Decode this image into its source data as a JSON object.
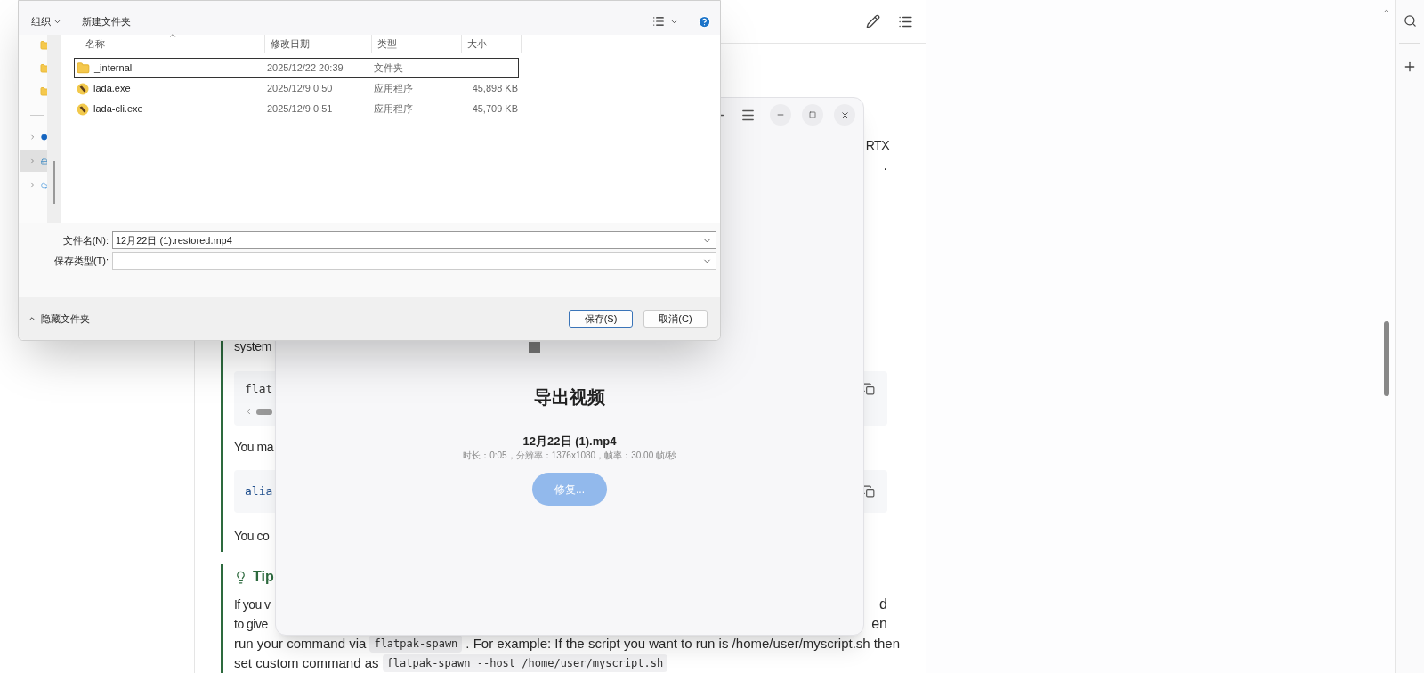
{
  "article": {
    "note_block": {
      "line_1_right": "RTX",
      "line_2_right": ".",
      "system_text": "system",
      "code_1": "flat",
      "you_may_text": "You ma",
      "code_2": "alia",
      "you_could_text": "You co"
    },
    "tip_block": {
      "title": "Tip",
      "line_1_left": "If you v",
      "line_1_right": "d",
      "line_2_left": "to give",
      "line_2_right": "en",
      "full_lines": [
        [
          {
            "kind": "text",
            "text": "run your command via"
          },
          {
            "kind": "code",
            "text": "flatpak-spawn"
          },
          {
            "kind": "text",
            "text": ". For example: If the script you want to run is /home/user/myscript.sh then"
          }
        ],
        [
          {
            "kind": "text",
            "text": "set custom command as"
          },
          {
            "kind": "code",
            "text": "flatpak-spawn --host /home/user/myscript.sh"
          }
        ]
      ]
    }
  },
  "export_window": {
    "title": "导出视频",
    "file_name": "12月22日 (1).mp4",
    "meta": "时长：0:05，分辨率：1376x1080，帧率：30.00 帧/秒",
    "repair_button": {
      "label": "修复...",
      "disabled": true
    }
  },
  "save_dialog": {
    "organize": "组织",
    "new_folder": "新建文件夹",
    "nav_items": [
      {
        "kind": "dot",
        "selected": false
      },
      {
        "kind": "drive",
        "selected": true
      },
      {
        "kind": "cloud",
        "selected": false
      }
    ],
    "columns": [
      "名称",
      "修改日期",
      "类型",
      "大小"
    ],
    "files": [
      {
        "kind": "folder",
        "name": "_internal",
        "modified": "2025/12/22 20:39",
        "type": "文件夹",
        "selected": true
      },
      {
        "kind": "app",
        "name": "lada.exe",
        "modified": "2025/12/9 0:50",
        "type": "应用程序",
        "size": "45,898 KB",
        "selected": false
      },
      {
        "kind": "app",
        "name": "lada-cli.exe",
        "modified": "2025/12/9 0:51",
        "type": "应用程序",
        "size": "45,709 KB",
        "selected": false
      }
    ],
    "file_name_label": "文件名(N):",
    "file_name_value": "12月22日 (1).restored.mp4",
    "file_type_label": "保存类型(T):",
    "hide_folders": "隐藏文件夹",
    "save": "保存(S)",
    "cancel": "取消(C)"
  }
}
